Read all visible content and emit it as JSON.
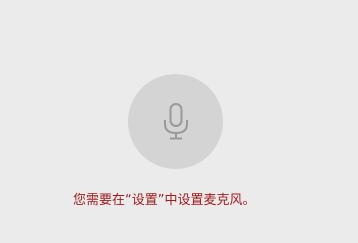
{
  "voice_panel": {
    "icon": "microphone-icon",
    "message": "您需要在“设置”中设置麦克风。"
  },
  "colors": {
    "background": "#ebebeb",
    "mic_button": "#d4d4d4",
    "icon": "#9a9a9a",
    "message_text": "#a01c1c"
  }
}
